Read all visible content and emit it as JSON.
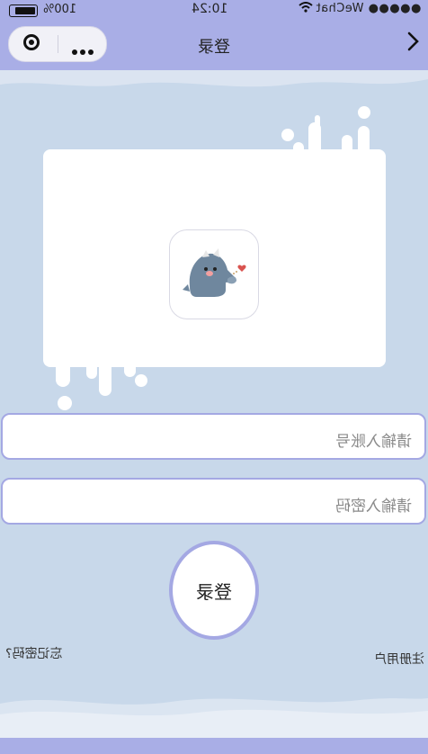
{
  "status_bar": {
    "battery_pct": "100%",
    "time": "10:24",
    "carrier": "●●●●● WeChat",
    "icons": [
      "battery-icon",
      "wifi-icon"
    ]
  },
  "nav": {
    "title": "登录",
    "icons": [
      "target-icon",
      "more-icon",
      "chevron-icon"
    ]
  },
  "logo": {
    "icon": "dinosaur-mascot-icon"
  },
  "form": {
    "account_placeholder": "请输入账号",
    "password_placeholder": "请输入密码",
    "login_label": "登录",
    "forgot_label": "忘记密码?",
    "register_label": "注册用户"
  },
  "colors": {
    "background": "#c8d8ea",
    "accent": "#a9aee6",
    "border": "#a4a8e3"
  }
}
